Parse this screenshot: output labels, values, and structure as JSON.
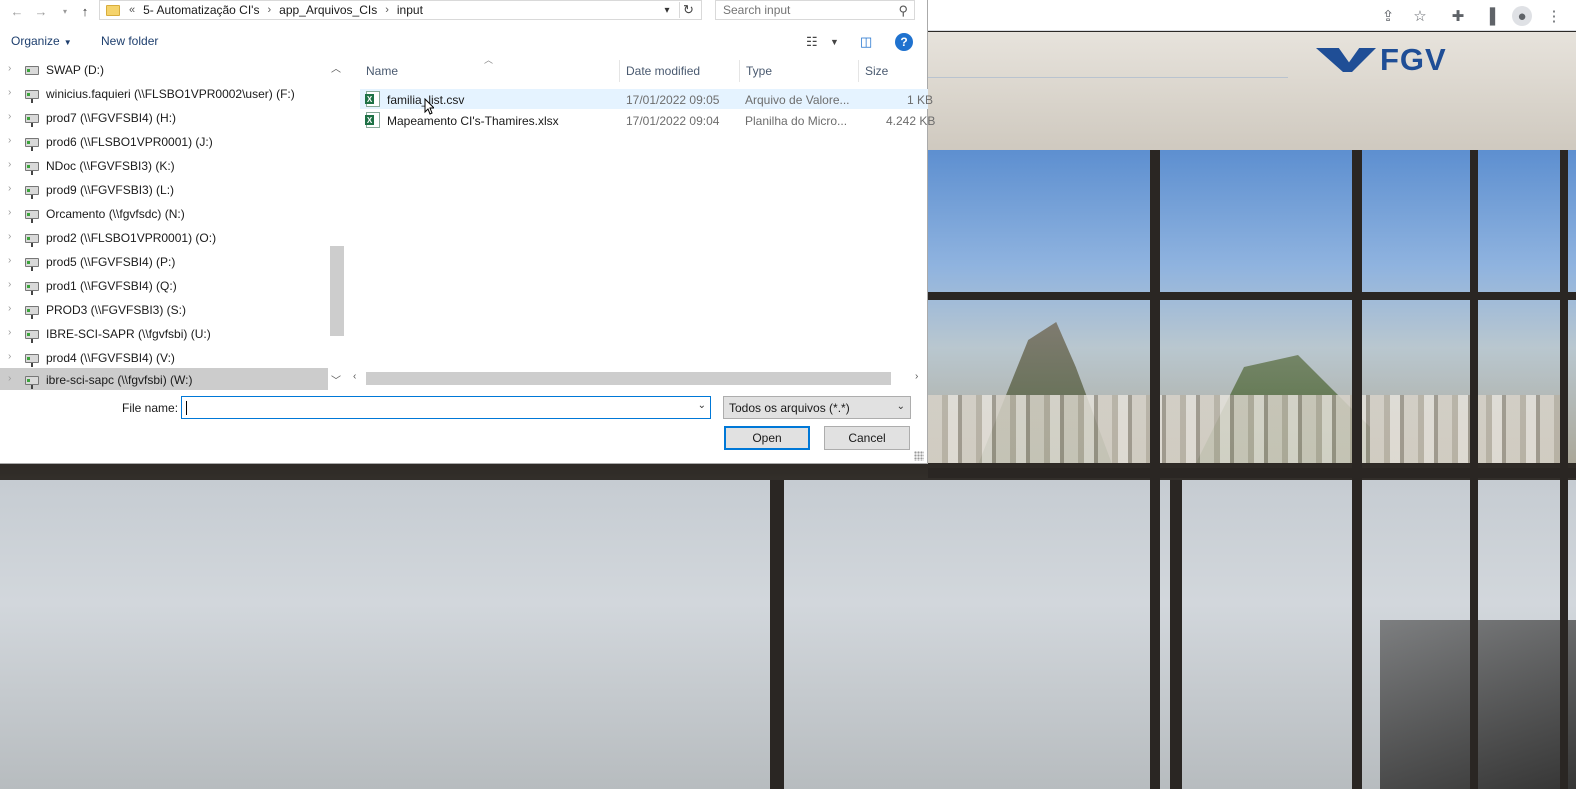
{
  "dialog": {
    "breadcrumb": {
      "overflow": "«",
      "segments": [
        "5- Automatização CI's",
        "app_Arquivos_CIs",
        "input"
      ]
    },
    "search": {
      "placeholder": "Search input"
    },
    "commands": {
      "organize": "Organize",
      "new_folder": "New folder"
    },
    "nav_items": [
      "SWAP (D:)",
      "winicius.faquieri (\\\\FLSBO1VPR0002\\user) (F:)",
      "prod7 (\\\\FGVFSBI4) (H:)",
      "prod6 (\\\\FLSBO1VPR0001) (J:)",
      "NDoc (\\\\FGVFSBI3) (K:)",
      "prod9 (\\\\FGVFSBI3) (L:)",
      "Orcamento (\\\\fgvfsdc) (N:)",
      "prod2 (\\\\FLSBO1VPR0001) (O:)",
      "prod5 (\\\\FGVFSBI4) (P:)",
      "prod1 (\\\\FGVFSBI4) (Q:)",
      "PROD3 (\\\\FGVFSBI3) (S:)",
      "IBRE-SCI-SAPR (\\\\fgvfsbi) (U:)",
      "prod4 (\\\\FGVFSBI4) (V:)",
      "ibre-sci-sapc (\\\\fgvfsbi) (W:)"
    ],
    "columns": {
      "name": "Name",
      "date": "Date modified",
      "type": "Type",
      "size": "Size"
    },
    "files": [
      {
        "name": "familia_list.csv",
        "date": "17/01/2022 09:05",
        "type": "Arquivo de Valore...",
        "size": "1 KB"
      },
      {
        "name": "Mapeamento CI's-Thamires.xlsx",
        "date": "17/01/2022 09:04",
        "type": "Planilha do Micro...",
        "size": "4.242 KB"
      }
    ],
    "file_name_label": "File name:",
    "file_name_value": "",
    "file_type": "Todos os arquivos (*.*)",
    "open_label": "Open",
    "cancel_label": "Cancel"
  },
  "background": {
    "logo_text": "FGV",
    "brand_color": "#1f4e96"
  }
}
